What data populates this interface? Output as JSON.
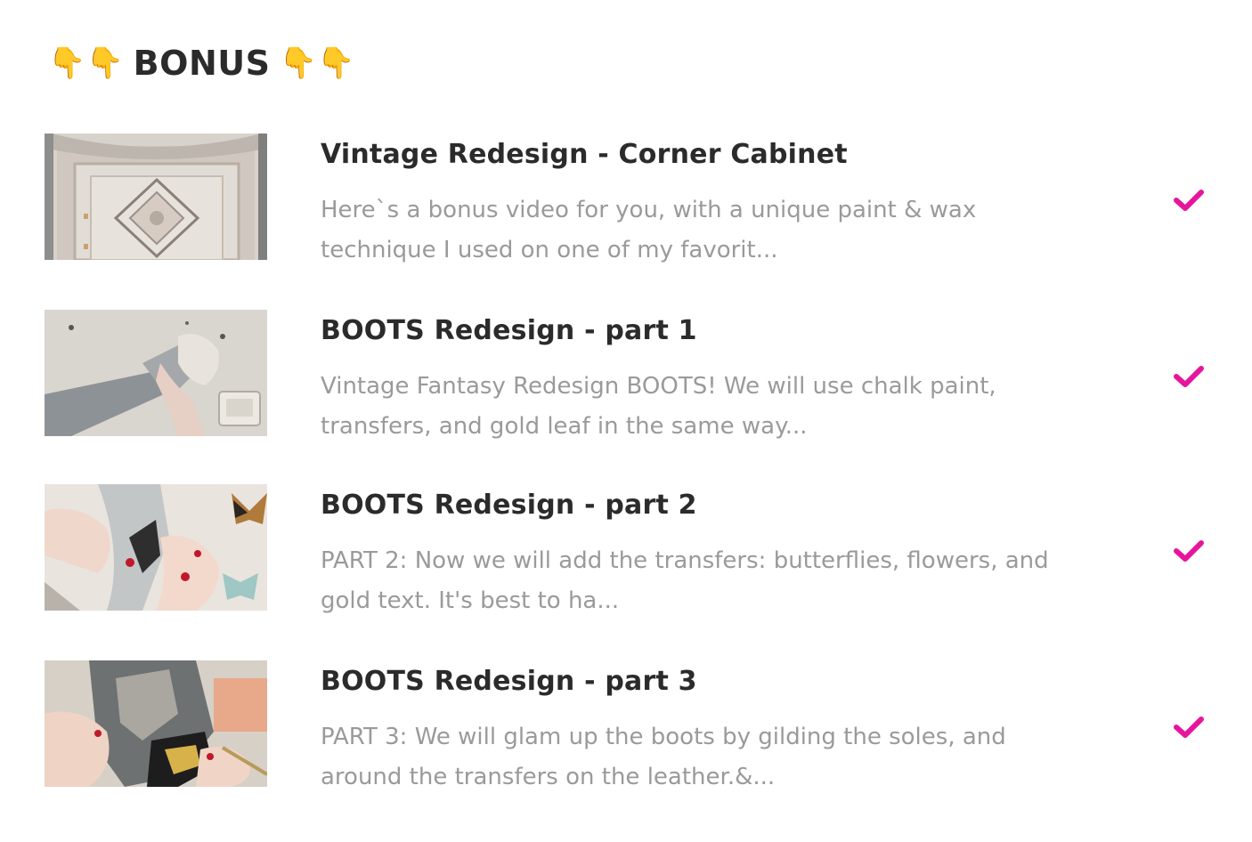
{
  "section": {
    "title": "BONUS",
    "emoji_left": "👇👇",
    "emoji_right": "👇👇"
  },
  "colors": {
    "check": "#e6169c",
    "title": "#2b2b2b",
    "description": "#9a9a9a"
  },
  "lessons": [
    {
      "title": "Vintage Redesign - Corner Cabinet",
      "description": "Here`s a bonus video for you, with a unique paint & wax technique I used on one of my favorit...",
      "completed": true,
      "thumbnail": "cabinet-thumbnail"
    },
    {
      "title": "BOOTS Redesign - part 1",
      "description": "Vintage Fantasy Redesign BOOTS! We will use chalk paint, transfers, and gold leaf in the same way...",
      "completed": true,
      "thumbnail": "boots-painting-thumbnail"
    },
    {
      "title": "BOOTS Redesign - part 2",
      "description": "PART 2: Now we will add the transfers: butterflies, flowers, and gold text.  It's best to ha...",
      "completed": true,
      "thumbnail": "butterfly-transfers-thumbnail"
    },
    {
      "title": "BOOTS Redesign - part 3",
      "description": "PART 3: We will glam up the boots by gilding the soles, and around the transfers on the leather.&...",
      "completed": true,
      "thumbnail": "gilding-thumbnail"
    }
  ]
}
